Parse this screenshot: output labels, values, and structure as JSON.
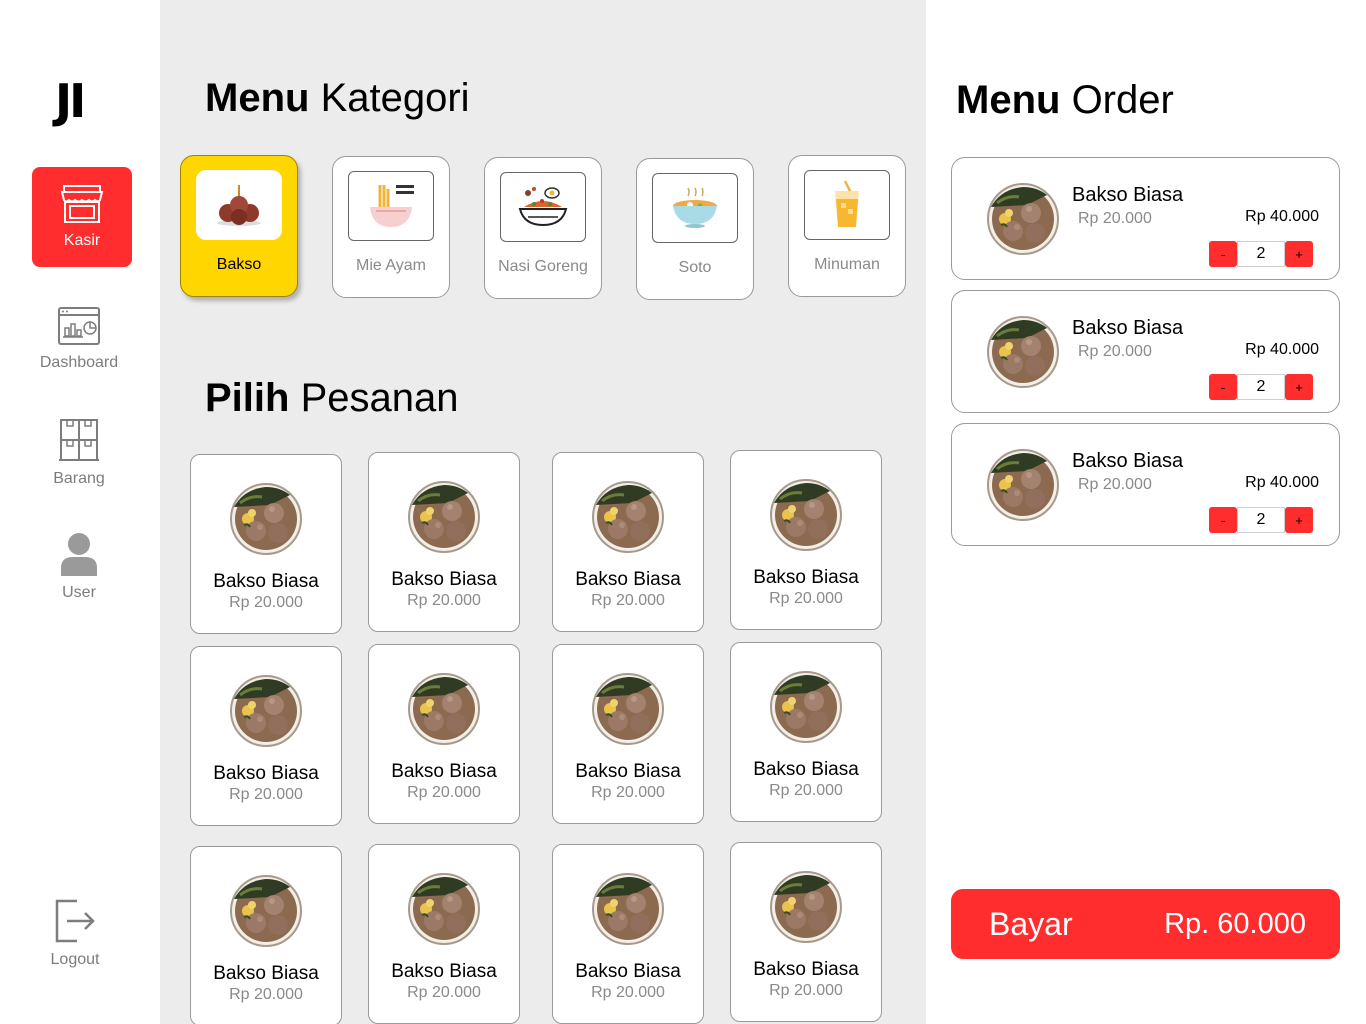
{
  "sidebar": {
    "logo": "JI",
    "items": [
      {
        "label": "Kasir",
        "icon": "store-icon"
      },
      {
        "label": "Dashboard",
        "icon": "dashboard-icon"
      },
      {
        "label": "Barang",
        "icon": "boxes-icon"
      },
      {
        "label": "User",
        "icon": "user-icon"
      }
    ],
    "logout": {
      "label": "Logout",
      "icon": "logout-icon"
    },
    "active_color": "#ff2d2d"
  },
  "kategori": {
    "title_bold": "Menu",
    "title_light": "Kategori",
    "items": [
      {
        "label": "Bakso",
        "icon": "meatball-icon",
        "active": true
      },
      {
        "label": "Mie Ayam",
        "icon": "noodle-icon",
        "active": false
      },
      {
        "label": "Nasi Goreng",
        "icon": "fried-rice-icon",
        "active": false
      },
      {
        "label": "Soto",
        "icon": "soup-icon",
        "active": false
      },
      {
        "label": "Minuman",
        "icon": "drink-icon",
        "active": false
      }
    ],
    "active_color": "#ffd600"
  },
  "pesanan": {
    "title_bold": "Pilih",
    "title_light": "Pesanan",
    "items": [
      {
        "name": "Bakso Biasa",
        "price": "Rp 20.000"
      },
      {
        "name": "Bakso Biasa",
        "price": "Rp 20.000"
      },
      {
        "name": "Bakso Biasa",
        "price": "Rp 20.000"
      },
      {
        "name": "Bakso Biasa",
        "price": "Rp 20.000"
      },
      {
        "name": "Bakso Biasa",
        "price": "Rp 20.000"
      },
      {
        "name": "Bakso Biasa",
        "price": "Rp 20.000"
      },
      {
        "name": "Bakso Biasa",
        "price": "Rp 20.000"
      },
      {
        "name": "Bakso Biasa",
        "price": "Rp 20.000"
      },
      {
        "name": "Bakso Biasa",
        "price": "Rp 20.000"
      },
      {
        "name": "Bakso Biasa",
        "price": "Rp 20.000"
      },
      {
        "name": "Bakso Biasa",
        "price": "Rp 20.000"
      },
      {
        "name": "Bakso Biasa",
        "price": "Rp 20.000"
      }
    ]
  },
  "order": {
    "title_bold": "Menu",
    "title_light": "Order",
    "items": [
      {
        "name": "Bakso Biasa",
        "price": "Rp 20.000",
        "total": "Rp 40.000",
        "qty": "2",
        "minus": "-",
        "plus": "+"
      },
      {
        "name": "Bakso Biasa",
        "price": "Rp 20.000",
        "total": "Rp 40.000",
        "qty": "2",
        "minus": "-",
        "plus": "+"
      },
      {
        "name": "Bakso Biasa",
        "price": "Rp 20.000",
        "total": "Rp 40.000",
        "qty": "2",
        "minus": "-",
        "plus": "+"
      }
    ],
    "pay_label": "Bayar",
    "pay_total": "Rp. 60.000",
    "pay_color": "#ff2d2d"
  }
}
